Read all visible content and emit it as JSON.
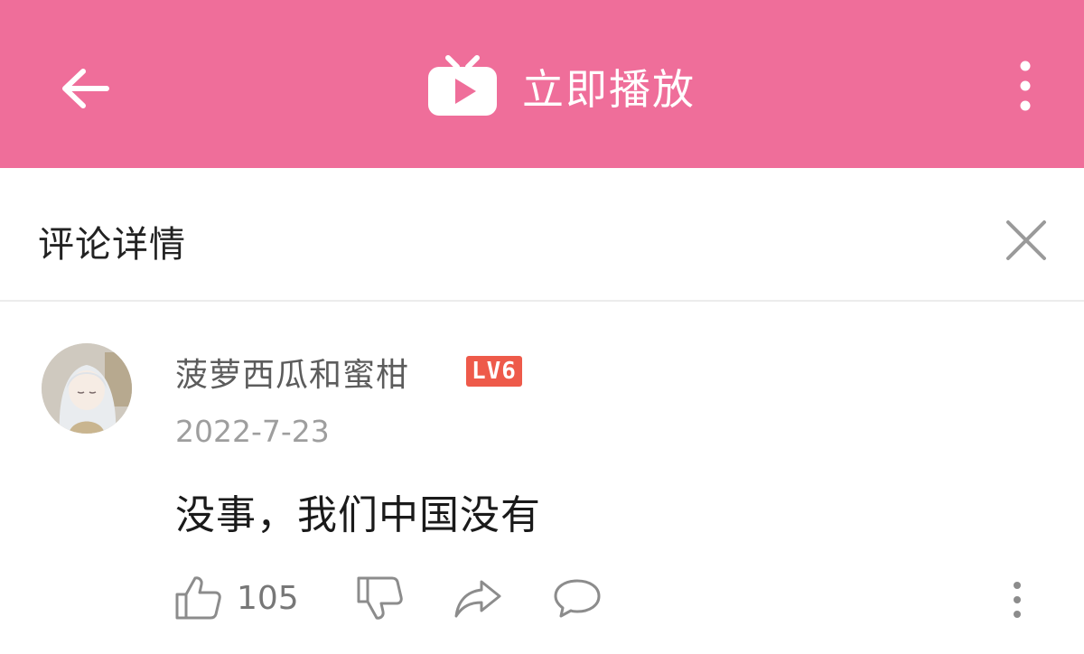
{
  "topbar": {
    "title": "立即播放",
    "background": "#ef6e9a",
    "back_icon": "arrow-left-icon",
    "logo_icon": "tv-play-icon",
    "more_icon": "more-vertical-icon"
  },
  "subheader": {
    "title": "评论详情",
    "close_icon": "close-icon"
  },
  "comment": {
    "username": "菠萝西瓜和蜜柑",
    "level": "LV6",
    "level_color": "#ee5a4a",
    "date": "2022-7-23",
    "text": "没事，我们中国没有",
    "likes": "105",
    "actions": [
      "thumbs-up-icon",
      "thumbs-down-icon",
      "share-icon",
      "reply-icon",
      "more-vertical-icon"
    ]
  }
}
